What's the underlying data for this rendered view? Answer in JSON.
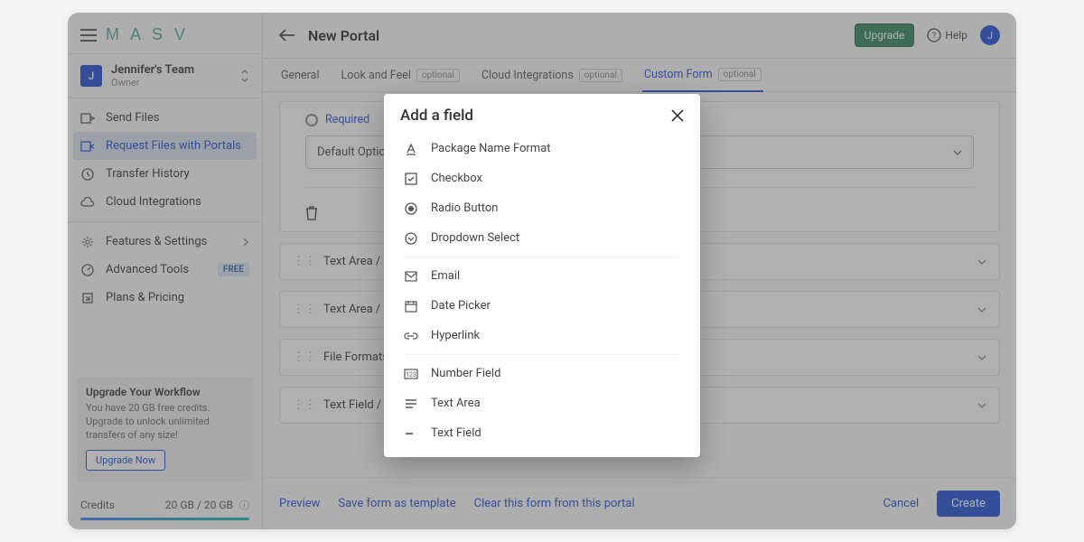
{
  "logo": "M A S V",
  "team": {
    "initial": "J",
    "name": "Jennifer's Team",
    "role": "Owner"
  },
  "nav": {
    "send": "Send Files",
    "request": "Request Files with Portals",
    "history": "Transfer History",
    "cloud": "Cloud Integrations",
    "features": "Features & Settings",
    "advanced": "Advanced Tools",
    "advanced_badge": "FREE",
    "plans": "Plans & Pricing"
  },
  "upgrade_box": {
    "title": "Upgrade Your Workflow",
    "text": "You have 20 GB free credits. Upgrade to unlock unlimited transfers of any size!",
    "btn": "Upgrade Now"
  },
  "credits": {
    "label": "Credits",
    "value": "20 GB / 20 GB"
  },
  "header": {
    "title": "New Portal",
    "upgrade": "Upgrade",
    "help": "Help"
  },
  "avatar_initial": "J",
  "tabs": {
    "general": "General",
    "look": "Look and Feel",
    "cloud": "Cloud Integrations",
    "custom": "Custom Form",
    "optional": "optional"
  },
  "form": {
    "required": "Required",
    "default_option": "Default Option",
    "rows": {
      "r1": "Text Area / lo",
      "r2": "Text Area / lo",
      "r3": "File Formats",
      "r4": "Text Field / s"
    }
  },
  "footer": {
    "preview": "Preview",
    "save_tpl": "Save form as template",
    "clear": "Clear this form from this portal",
    "cancel": "Cancel",
    "create": "Create"
  },
  "modal": {
    "title": "Add a field",
    "items_a": {
      "pkg": "Package Name Format",
      "checkbox": "Checkbox",
      "radio": "Radio Button",
      "dropdown": "Dropdown Select"
    },
    "items_b": {
      "email": "Email",
      "date": "Date Picker",
      "hyperlink": "Hyperlink"
    },
    "items_c": {
      "number": "Number Field",
      "textarea": "Text Area",
      "textfield": "Text Field"
    }
  }
}
